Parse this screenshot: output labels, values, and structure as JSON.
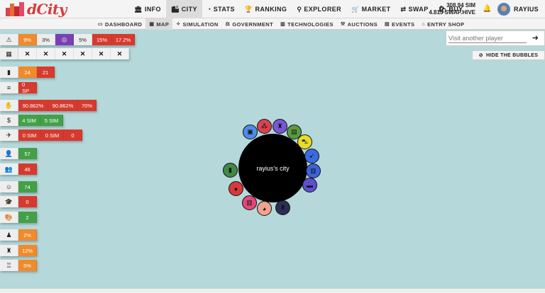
{
  "brand": {
    "name": "dCity"
  },
  "nav": [
    {
      "label": "INFO",
      "icon": "bank-icon",
      "glyph": "🏛"
    },
    {
      "label": "CITY",
      "icon": "city-icon",
      "glyph": "🏙",
      "active": true
    },
    {
      "label": "STATS",
      "icon": "gauge-icon",
      "glyph": "◔"
    },
    {
      "label": "RANKING",
      "icon": "trophy-icon",
      "glyph": "🏆"
    },
    {
      "label": "EXPLORER",
      "icon": "search-icon",
      "glyph": "⚲"
    },
    {
      "label": "MARKET",
      "icon": "cart-icon",
      "glyph": "🛒"
    },
    {
      "label": "SWAP",
      "icon": "swap-icon",
      "glyph": "⇄"
    },
    {
      "label": "BUY",
      "icon": "cart-plus-icon",
      "glyph": "🛍"
    }
  ],
  "balance": {
    "sim": "308.94 SIM",
    "hive": "4.815 SWAP.HIVE"
  },
  "user": {
    "name": "RAYIUS"
  },
  "subnav": [
    {
      "label": "DASHBOARD",
      "glyph": "▭"
    },
    {
      "label": "MAP",
      "glyph": "▦",
      "active": true
    },
    {
      "label": "SIMULATION",
      "glyph": "✧"
    },
    {
      "label": "GOVERNMENT",
      "glyph": "⚖"
    },
    {
      "label": "TECHNOLOGIES",
      "glyph": "▥"
    },
    {
      "label": "AUCTIONS",
      "glyph": "⚒"
    },
    {
      "label": "EVENTS",
      "glyph": "▤"
    },
    {
      "label": "ENTRY SHOP",
      "glyph": "⌂"
    }
  ],
  "visit": {
    "placeholder": "Visit another player"
  },
  "bubbles_toggle": {
    "label": "HIDE THE BUBBLES"
  },
  "stats": {
    "risks": {
      "icon": "warning-icon",
      "glyph": "⚠",
      "values": [
        "9%",
        "3%",
        "☹",
        "5%",
        "15%",
        "17.2%"
      ]
    },
    "calendar": {
      "icon": "calendar-icon",
      "glyph": "▦",
      "values": [
        "✕",
        "✕",
        "✕",
        "✕",
        "✕",
        "✕"
      ]
    },
    "buildings": {
      "icon": "building-icon",
      "glyph": "▮",
      "values": [
        "24",
        "21"
      ]
    },
    "sp": {
      "icon": "coins-icon",
      "glyph": "≡",
      "values": [
        "0 SP"
      ]
    },
    "income_pct": {
      "icon": "hand-coin-icon",
      "glyph": "✋",
      "values": [
        "90.862%",
        "90.862%",
        "70%"
      ]
    },
    "income": {
      "icon": "dollar-icon",
      "glyph": "$",
      "values": [
        "4 SIM",
        "5 SIM"
      ]
    },
    "tourism": {
      "icon": "plane-icon",
      "glyph": "✈",
      "values": [
        "0 SIM",
        "0 SIM",
        "0"
      ]
    },
    "population": {
      "icon": "user-icon",
      "glyph": "👤",
      "values": [
        "57"
      ]
    },
    "workers": {
      "icon": "users-icon",
      "glyph": "👥",
      "values": [
        "46"
      ]
    },
    "happiness": {
      "icon": "smile-icon",
      "glyph": "☺",
      "values": [
        "74"
      ]
    },
    "education": {
      "icon": "graduation-cap-icon",
      "glyph": "🎓",
      "values": [
        "0"
      ]
    },
    "culture": {
      "icon": "palette-icon",
      "glyph": "🎨",
      "values": [
        "2"
      ]
    },
    "crime": {
      "icon": "thief-icon",
      "glyph": "♟",
      "values": [
        "2%"
      ]
    },
    "unemployment": {
      "icon": "worker-icon",
      "glyph": "♜",
      "values": [
        "12%"
      ]
    },
    "pollution": {
      "icon": "factory-icon",
      "glyph": "♖",
      "values": [
        "5%"
      ]
    }
  },
  "city": {
    "name": "rayius's city"
  },
  "city_bubbles": [
    {
      "icon": "id-card-icon",
      "glyph": "▣",
      "color": "#4f8ce8"
    },
    {
      "icon": "network-icon",
      "glyph": "⁂",
      "color": "#d9434d"
    },
    {
      "icon": "worker-icon",
      "glyph": "♜",
      "color": "#7a55d6"
    },
    {
      "icon": "clipboard-icon",
      "glyph": "▤",
      "color": "#5a9a3f"
    },
    {
      "icon": "car-icon",
      "glyph": "⛍",
      "color": "#e6dc2a"
    },
    {
      "icon": "rocket-icon",
      "glyph": "➹",
      "color": "#3a6be0"
    },
    {
      "icon": "bus-icon",
      "glyph": "▥",
      "color": "#3f63d8"
    },
    {
      "icon": "briefcase-icon",
      "glyph": "▬",
      "color": "#5c50cf"
    },
    {
      "icon": "worker-icon",
      "glyph": "♜",
      "color": "#2b2f55"
    },
    {
      "icon": "palette-icon",
      "glyph": "◕",
      "color": "#f0a38f"
    },
    {
      "icon": "bus-icon",
      "glyph": "▥",
      "color": "#e2477a"
    },
    {
      "icon": "map-pin-icon",
      "glyph": "●",
      "color": "#d63a3a"
    },
    {
      "icon": "building-icon",
      "glyph": "▮",
      "color": "#3f8a45"
    }
  ]
}
